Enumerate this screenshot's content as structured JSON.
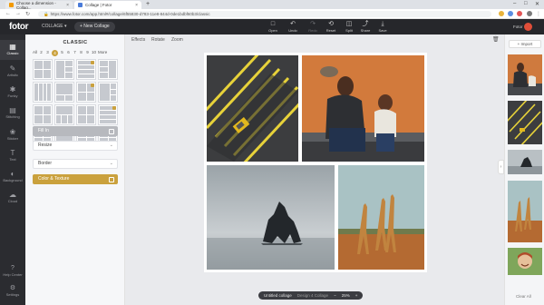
{
  "browser": {
    "tabs": [
      {
        "title": "Choose a dimension - Collag..."
      },
      {
        "title": "Collage | Fotor"
      }
    ],
    "new_tab": "+",
    "url": "https://www.fotor.com/app.html#/collage/6f55830-d783-11e8-844d-0de1bdbf60b3/classic",
    "back": "←",
    "forward": "→",
    "reload": "↻",
    "window_controls": [
      "–",
      "□",
      "✕"
    ]
  },
  "app": {
    "logo": "fotor",
    "mode": "COLLAGE ▾",
    "new_collage": "+ New Collage",
    "toolbar": [
      {
        "icon": "□",
        "label": "Open",
        "disabled": false
      },
      {
        "icon": "↶",
        "label": "Undo",
        "disabled": false
      },
      {
        "icon": "↷",
        "label": "Redo",
        "disabled": true
      },
      {
        "icon": "⟲",
        "label": "Reset",
        "disabled": false
      },
      {
        "icon": "◫",
        "label": "Split",
        "disabled": false
      },
      {
        "icon": "⤴",
        "label": "Share",
        "disabled": false
      },
      {
        "icon": "⤓",
        "label": "Save",
        "disabled": false
      }
    ],
    "user_label": "Fotor"
  },
  "rail": [
    {
      "icon": "▦",
      "label": "Classic",
      "active": true
    },
    {
      "icon": "✎",
      "label": "Artistic",
      "active": false
    },
    {
      "icon": "✱",
      "label": "Funky",
      "active": false
    },
    {
      "icon": "▤",
      "label": "Stitching",
      "active": false
    },
    {
      "icon": "❀",
      "label": "Sticker",
      "active": false
    },
    {
      "icon": "T",
      "label": "Text",
      "active": false
    },
    {
      "icon": "◐",
      "label": "Background",
      "active": false
    },
    {
      "icon": "☁",
      "label": "Cloud",
      "active": false
    }
  ],
  "rail_bottom": [
    {
      "icon": "?",
      "label": "Help Center"
    },
    {
      "icon": "⚙",
      "label": "Settings"
    }
  ],
  "panel": {
    "title": "CLASSIC",
    "counts": [
      "All",
      "2",
      "3",
      "4",
      "5",
      "6",
      "7",
      "8",
      "9",
      "10",
      "More"
    ],
    "selected_count": "4",
    "options": [
      {
        "label": "Fill In",
        "style": "grey"
      },
      {
        "label": "Resize",
        "style": "plain"
      },
      {
        "label": "Border",
        "style": "plain"
      },
      {
        "label": "Color & Texture",
        "style": "gold"
      }
    ]
  },
  "canvas_tools": [
    "Effects",
    "Rotate",
    "Zoom"
  ],
  "status": {
    "name": "Untitled collage",
    "size": "Design 4 Collage",
    "zoom": "25%",
    "zoom_out": "−",
    "zoom_in": "+"
  },
  "sidebar": {
    "import": "+ Import",
    "clear_all": "Clear All",
    "collapse": "›"
  }
}
